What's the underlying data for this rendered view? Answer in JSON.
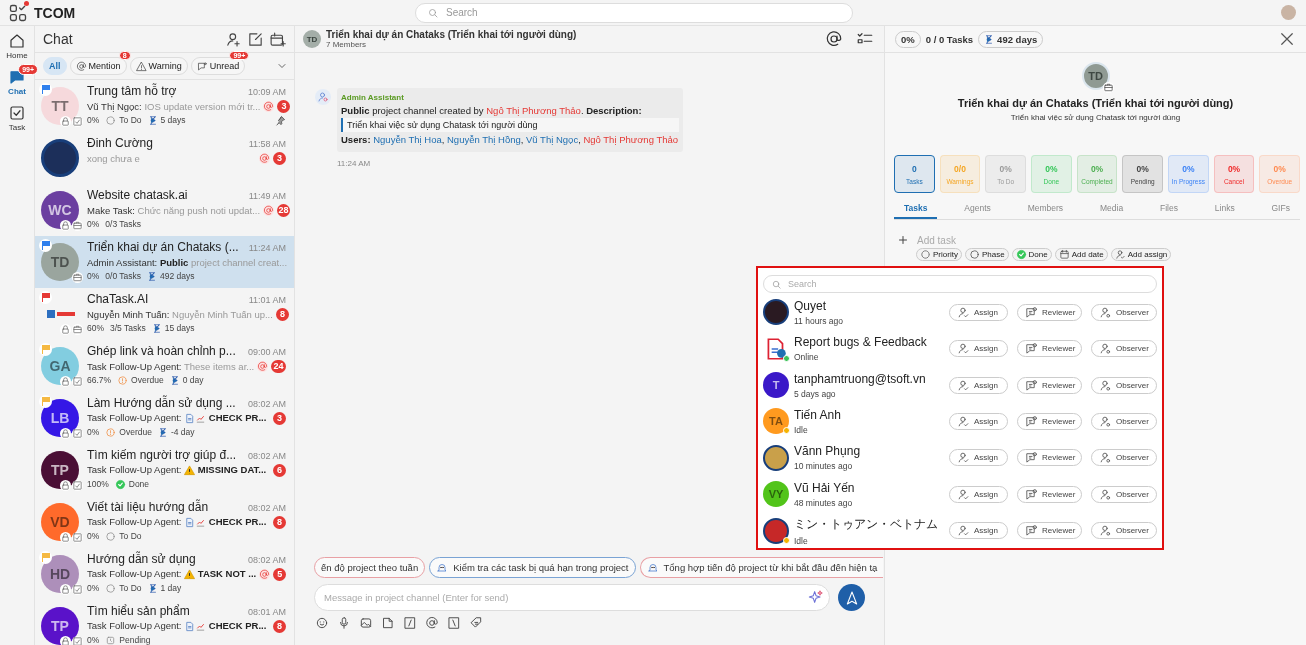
{
  "app": {
    "name": "TCOM",
    "notification_dot": true
  },
  "search": {
    "placeholder": "Search"
  },
  "nav": [
    {
      "label": "Home",
      "kind": "home",
      "selected": false
    },
    {
      "label": "Chat",
      "kind": "chat",
      "selected": true,
      "badge": "99+"
    },
    {
      "label": "Task",
      "kind": "task",
      "selected": false
    }
  ],
  "chat_list": {
    "title": "Chat",
    "filters": [
      {
        "label": "All",
        "kind": "all",
        "selected": true
      },
      {
        "label": "Mention",
        "kind": "mention",
        "selected": false,
        "badge": "8"
      },
      {
        "label": "Warning",
        "kind": "warning",
        "selected": false
      },
      {
        "label": "Unread",
        "kind": "unread",
        "selected": false,
        "badge": "99+"
      }
    ],
    "items": [
      {
        "name": "Trung tâm hỗ trợ",
        "time": "10:09 AM",
        "avatar": {
          "kind": "initials",
          "text": "TT",
          "color": "#f6d9dc"
        },
        "flag": {
          "color": "#2f80ed"
        },
        "badges": [
          {
            "kind": "lock"
          },
          {
            "kind": "check"
          }
        ],
        "sender": "Vũ Thị Ngọc:",
        "preview": "IOS update version mới tr...",
        "mention": true,
        "unread": "3",
        "pinned": true,
        "progress": "0%",
        "status": {
          "kind": "todo",
          "label": "To Do"
        },
        "duration": "5 days",
        "selected": false
      },
      {
        "name": "Đinh Cường",
        "time": "11:58 AM",
        "avatar": {
          "kind": "image"
        },
        "preview": "xong chưa e",
        "mention": true,
        "unread": "3",
        "pinned": false,
        "selected": false
      },
      {
        "name": "Website chatask.ai",
        "time": "11:49 AM",
        "avatar": {
          "kind": "initials",
          "text": "WC",
          "color": "#6b3fa0"
        },
        "badges": [
          {
            "kind": "lock"
          },
          {
            "kind": "case"
          }
        ],
        "sender": "Make Task:",
        "preview": "Chức năng push noti updat...",
        "mention": true,
        "unread": "28",
        "pinned": false,
        "progress": "0%",
        "tasks": "0/3 Tasks",
        "selected": false
      },
      {
        "name": "Triển khai dự án Chataks (...",
        "time": "11:24 AM",
        "avatar": {
          "kind": "initials",
          "text": "TD",
          "color": "#9aa59e"
        },
        "flag": {
          "color": "#2f80ed"
        },
        "badges": [
          {
            "kind": "case"
          }
        ],
        "sender": "Admin Assistant:",
        "preview": "**Public** project channel creat...",
        "mention": false,
        "pinned": false,
        "progress": "0%",
        "tasks": "0/0 Tasks",
        "duration": "492 days",
        "selected": true
      },
      {
        "name": "ChaTask.AI",
        "time": "11:01 AM",
        "avatar": {
          "kind": "logo"
        },
        "flag": {
          "color": "#e53935"
        },
        "badges": [
          {
            "kind": "lock"
          },
          {
            "kind": "case"
          }
        ],
        "sender": "Nguyễn Minh Tuấn:",
        "preview": "Nguyễn Minh Tuấn up...",
        "mention": false,
        "unread": "8",
        "pinned": false,
        "progress": "60%",
        "tasks": "3/5 Tasks",
        "duration": "15 days",
        "selected": false
      },
      {
        "name": "Ghép link và hoàn chỉnh p...",
        "time": "09:00 AM",
        "avatar": {
          "kind": "initials",
          "text": "GA",
          "color": "#82cde0"
        },
        "flag": {
          "color": "#f5b942"
        },
        "badges": [
          {
            "kind": "lock"
          },
          {
            "kind": "check"
          }
        ],
        "sender": "Task Follow-Up Agent:",
        "preview": "These items ar...",
        "mention": true,
        "unread": "24",
        "pinned": false,
        "progress": "66.7%",
        "status": {
          "kind": "overdue",
          "label": "Overdue"
        },
        "duration": "0 day",
        "selected": false
      },
      {
        "name": "Làm Hướng dẫn sử dụng ...",
        "time": "08:02 AM",
        "avatar": {
          "kind": "initials",
          "text": "LB",
          "color": "#3517e6"
        },
        "flag": {
          "color": "#f5b942"
        },
        "badges": [
          {
            "kind": "lock"
          },
          {
            "kind": "check"
          }
        ],
        "sender": "Task Follow-Up Agent:",
        "preview_icon": {
          "kind": "report"
        },
        "preview": "**CHECK PR...**",
        "mention": false,
        "unread": "3",
        "pinned": false,
        "progress": "0%",
        "status": {
          "kind": "overdue",
          "label": "Overdue"
        },
        "duration": "-4 day",
        "selected": false
      },
      {
        "name": "Tìm kiếm người trợ giúp đ...",
        "time": "08:02 AM",
        "avatar": {
          "kind": "initials",
          "text": "TP",
          "color": "#4a0f35"
        },
        "badges": [
          {
            "kind": "lock"
          },
          {
            "kind": "check"
          }
        ],
        "sender": "Task Follow-Up Agent:",
        "preview_icon": {
          "kind": "warning"
        },
        "preview": "**MISSING DAT...**",
        "mention": false,
        "unread": "6",
        "pinned": false,
        "progress": "100%",
        "status": {
          "kind": "done",
          "label": "Done"
        },
        "selected": false
      },
      {
        "name": "Viết tài liệu hướng dẫn",
        "time": "08:02 AM",
        "avatar": {
          "kind": "initials",
          "text": "VD",
          "color": "#ff6a2b"
        },
        "badges": [
          {
            "kind": "lock"
          },
          {
            "kind": "check"
          }
        ],
        "sender": "Task Follow-Up Agent:",
        "preview_icon": {
          "kind": "report"
        },
        "preview": "**CHECK PR...**",
        "mention": false,
        "unread": "8",
        "pinned": false,
        "progress": "0%",
        "status": {
          "kind": "todo",
          "label": "To Do"
        },
        "selected": false
      },
      {
        "name": "Hướng dẫn sử dụng",
        "time": "08:02 AM",
        "avatar": {
          "kind": "initials",
          "text": "HD",
          "color": "#ad8fba"
        },
        "flag": {
          "color": "#f5b942"
        },
        "badges": [
          {
            "kind": "lock"
          },
          {
            "kind": "check"
          }
        ],
        "sender": "Task Follow-Up Agent:",
        "preview_icon": {
          "kind": "warning"
        },
        "preview": "**TASK NOT ...**",
        "mention": true,
        "unread": "5",
        "pinned": false,
        "progress": "0%",
        "status": {
          "kind": "todo",
          "label": "To Do"
        },
        "duration": "1 day",
        "selected": false
      },
      {
        "name": "Tìm hiểu sản phẩm",
        "time": "08:01 AM",
        "avatar": {
          "kind": "initials",
          "text": "TP",
          "color": "#5a12c9"
        },
        "badges": [
          {
            "kind": "lock"
          },
          {
            "kind": "check"
          }
        ],
        "sender": "Task Follow-Up Agent:",
        "preview_icon": {
          "kind": "report"
        },
        "preview": "**CHECK PR...**",
        "mention": false,
        "unread": "8",
        "pinned": false,
        "progress": "0%",
        "status": {
          "kind": "pending",
          "label": "Pending"
        },
        "selected": false
      }
    ]
  },
  "channel": {
    "avatar_text": "TD",
    "title": "Triển khai dự án Chataks (Triển khai tới người dùng)",
    "members": "7 Members",
    "message": {
      "sender": "Admin Assistant",
      "lines": [
        {
          "kind": "text",
          "segments": [
            {
              "kind": "bold",
              "text": "Public"
            },
            {
              "kind": "plain",
              "text": " project channel created by "
            },
            {
              "kind": "person",
              "text": "Ngô Thị Phương Thảo"
            },
            {
              "kind": "plain",
              "text": ". "
            },
            {
              "kind": "bold",
              "text": "Description:"
            }
          ]
        },
        {
          "kind": "quote",
          "segments": [
            {
              "kind": "plain",
              "text": "Triển khai việc sử dụng Chatask tới người dùng"
            }
          ]
        },
        {
          "kind": "text",
          "segments": [
            {
              "kind": "bold",
              "text": "Users: "
            },
            {
              "kind": "user",
              "text": "Nguyễn Thị Hoa"
            },
            {
              "kind": "plain",
              "text": ", "
            },
            {
              "kind": "user",
              "text": "Nguyễn Thị Hồng"
            },
            {
              "kind": "plain",
              "text": ", "
            },
            {
              "kind": "user",
              "text": "Vũ Thị Ngọc"
            },
            {
              "kind": "plain",
              "text": ", "
            },
            {
              "kind": "person",
              "text": "Ngô Thị Phương Thảo"
            }
          ]
        }
      ],
      "time": "11:24 AM"
    },
    "suggestions": [
      {
        "text": "ến độ project theo tuần",
        "icon": false
      },
      {
        "text": "Kiểm tra các task bị quá hạn trong project",
        "icon": true
      },
      {
        "text": "Tổng hợp tiến độ project từ khi bắt đầu đến hiện tạ",
        "icon": true
      }
    ],
    "composer": {
      "placeholder": "Message in project channel (Enter for send)"
    }
  },
  "panel": {
    "progress": "0%",
    "tasks": "0 / 0 Tasks",
    "duration": "492 days",
    "avatar_text": "TD",
    "title": "Triển khai dự án Chataks (Triển khai tới người dùng)",
    "description": "Triển khai việc sử dụng Chatask tới người dùng",
    "stats": [
      {
        "value": "0",
        "label": "Tasks",
        "color": "#1f6fb2",
        "selected": true
      },
      {
        "value": "0/0",
        "label": "Warnings",
        "color": "#f5a623",
        "selected": false
      },
      {
        "value": "0%",
        "label": "To Do",
        "color": "#9a9a9a",
        "selected": false
      },
      {
        "value": "0%",
        "label": "Done",
        "color": "#35c759",
        "selected": false
      },
      {
        "value": "0%",
        "label": "Completed",
        "color": "#4caf50",
        "selected": false
      },
      {
        "value": "0%",
        "label": "Pending",
        "color": "#444444",
        "selected": false
      },
      {
        "value": "0%",
        "label": "In Progress",
        "color": "#3b82f6",
        "selected": false
      },
      {
        "value": "0%",
        "label": "Cancel",
        "color": "#f02a2a",
        "selected": false
      },
      {
        "value": "0%",
        "label": "Overdue",
        "color": "#ff8a50",
        "selected": false
      }
    ],
    "tabs": [
      {
        "label": "Tasks",
        "selected": true
      },
      {
        "label": "Agents",
        "selected": false
      },
      {
        "label": "Members",
        "selected": false
      },
      {
        "label": "Media",
        "selected": false
      },
      {
        "label": "Files",
        "selected": false
      },
      {
        "label": "Links",
        "selected": false
      },
      {
        "label": "GIFs",
        "selected": false
      }
    ],
    "add_task": {
      "placeholder": "Add task"
    },
    "chips": [
      {
        "label": "Priority",
        "kind": "priority"
      },
      {
        "label": "Phase",
        "kind": "phase"
      },
      {
        "label": "Done",
        "kind": "done"
      },
      {
        "label": "Add date",
        "kind": "date"
      },
      {
        "label": "Add assign",
        "kind": "assign"
      }
    ]
  },
  "assign_popup": {
    "search_placeholder": "Search",
    "members": [
      {
        "name": "Quyet",
        "status": "11 hours ago",
        "avatar": {
          "kind": "image",
          "color": "#2a1a22"
        },
        "buttons": [
          "Assign",
          "Reviewer",
          "Observer"
        ]
      },
      {
        "name": "Report bugs & Feedback",
        "status": "Online",
        "avatar": {
          "kind": "doc"
        },
        "presence": {
          "color": "#3fc35a"
        },
        "buttons": [
          "Assign",
          "Reviewer",
          "Observer"
        ]
      },
      {
        "name": "tanphamtruong@tsoft.vn",
        "status": "5 days ago",
        "avatar": {
          "kind": "initials",
          "text": "T",
          "color": "#3a18c8"
        },
        "buttons": [
          "Assign",
          "Reviewer",
          "Observer"
        ]
      },
      {
        "name": "Tiến Anh",
        "status": "Idle",
        "avatar": {
          "kind": "initials",
          "text": "TA",
          "color": "#ff9a1f"
        },
        "presence": {
          "color": "#f5b400"
        },
        "buttons": [
          "Assign",
          "Reviewer",
          "Observer"
        ]
      },
      {
        "name": "Vănn Phụng",
        "status": "10 minutes ago",
        "avatar": {
          "kind": "image",
          "color": "#c9a04a"
        },
        "buttons": [
          "Assign",
          "Reviewer",
          "Observer"
        ]
      },
      {
        "name": "Vũ Hải Yến",
        "status": "48 minutes ago",
        "avatar": {
          "kind": "initials",
          "text": "VY",
          "color": "#52c41a"
        },
        "buttons": [
          "Assign",
          "Reviewer",
          "Observer"
        ]
      },
      {
        "name": "ミン・トゥアン・ベトナム",
        "status": "Idle",
        "avatar": {
          "kind": "image",
          "color": "#c62828"
        },
        "presence": {
          "color": "#f5b400"
        },
        "buttons": [
          "Assign",
          "Reviewer",
          "Observer"
        ]
      }
    ]
  }
}
